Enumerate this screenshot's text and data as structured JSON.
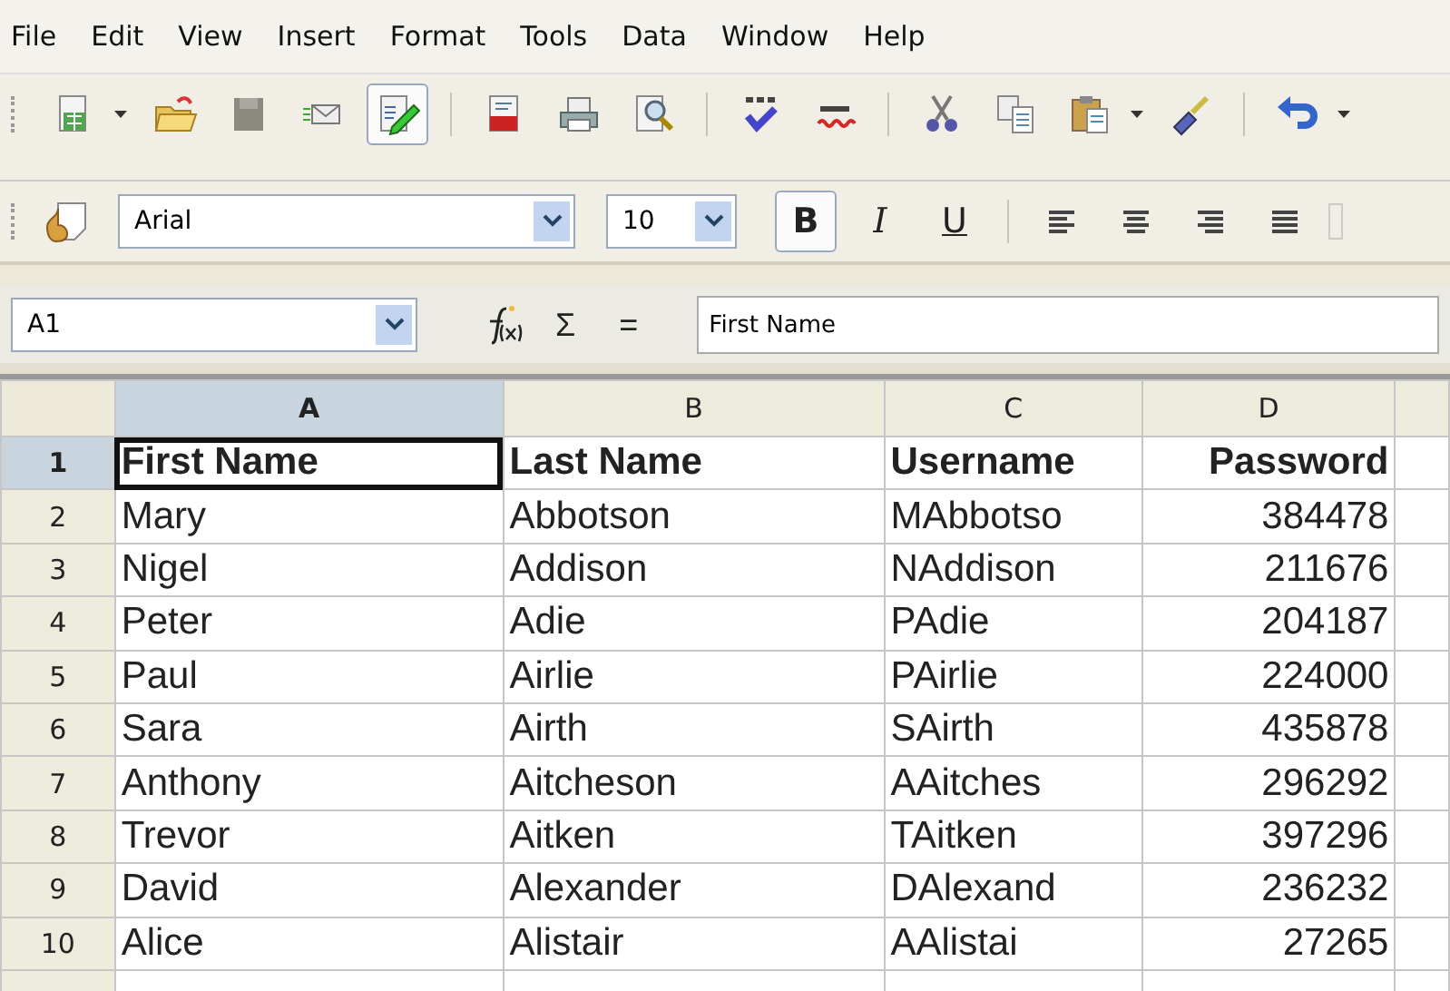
{
  "menu": [
    "File",
    "Edit",
    "View",
    "Insert",
    "Format",
    "Tools",
    "Data",
    "Window",
    "Help"
  ],
  "standard_toolbar": [
    {
      "kind": "new",
      "pressed": false,
      "dropdown": true
    },
    {
      "kind": "open",
      "pressed": false,
      "dropdown": false
    },
    {
      "kind": "save",
      "pressed": false,
      "dropdown": false
    },
    {
      "kind": "mail",
      "pressed": false,
      "dropdown": false
    },
    {
      "kind": "edit",
      "pressed": true,
      "dropdown": false
    },
    {
      "kind": "sep"
    },
    {
      "kind": "pdf",
      "pressed": false,
      "dropdown": false
    },
    {
      "kind": "print",
      "pressed": false,
      "dropdown": false
    },
    {
      "kind": "preview",
      "pressed": false,
      "dropdown": false
    },
    {
      "kind": "sep"
    },
    {
      "kind": "spell",
      "pressed": false,
      "dropdown": false
    },
    {
      "kind": "autospell",
      "pressed": false,
      "dropdown": false
    },
    {
      "kind": "sep"
    },
    {
      "kind": "cut",
      "pressed": false,
      "dropdown": false
    },
    {
      "kind": "copy",
      "pressed": false,
      "dropdown": false
    },
    {
      "kind": "paste",
      "pressed": false,
      "dropdown": true
    },
    {
      "kind": "brush",
      "pressed": false,
      "dropdown": false
    },
    {
      "kind": "sep"
    },
    {
      "kind": "undo",
      "pressed": false,
      "dropdown": true
    }
  ],
  "font_name": "Arial",
  "font_size": "10",
  "format_toolbar": [
    {
      "kind": "bold",
      "label": "B",
      "pressed": true
    },
    {
      "kind": "italic",
      "label": "I",
      "pressed": false
    },
    {
      "kind": "underline",
      "label": "U",
      "pressed": false
    },
    {
      "kind": "sep"
    },
    {
      "kind": "align-left",
      "pressed": false
    },
    {
      "kind": "align-center",
      "pressed": false
    },
    {
      "kind": "align-right",
      "pressed": false
    },
    {
      "kind": "justify",
      "pressed": false
    }
  ],
  "name_box": "A1",
  "formula_symbols": [
    "Σ",
    "="
  ],
  "formula": "First Name",
  "columns": [
    {
      "label": "A",
      "selected": true
    },
    {
      "label": "B",
      "selected": false
    },
    {
      "label": "C",
      "selected": false
    },
    {
      "label": "D",
      "selected": false
    }
  ],
  "rows": [
    {
      "number": "1",
      "selected": true,
      "bold": true,
      "cells": [
        "First Name",
        "Last Name",
        "Username",
        "Password"
      ]
    },
    {
      "number": "2",
      "selected": false,
      "bold": false,
      "cells": [
        "Mary",
        "Abbotson",
        "MAbbotso",
        "384478"
      ]
    },
    {
      "number": "3",
      "selected": false,
      "bold": false,
      "cells": [
        "Nigel",
        "Addison",
        "NAddison",
        "211676"
      ]
    },
    {
      "number": "4",
      "selected": false,
      "bold": false,
      "cells": [
        "Peter",
        "Adie",
        "PAdie",
        "204187"
      ]
    },
    {
      "number": "5",
      "selected": false,
      "bold": false,
      "cells": [
        "Paul",
        "Airlie",
        "PAirlie",
        "224000"
      ]
    },
    {
      "number": "6",
      "selected": false,
      "bold": false,
      "cells": [
        "Sara",
        "Airth",
        "SAirth",
        "435878"
      ]
    },
    {
      "number": "7",
      "selected": false,
      "bold": false,
      "cells": [
        "Anthony",
        "Aitcheson",
        "AAitches",
        "296292"
      ]
    },
    {
      "number": "8",
      "selected": false,
      "bold": false,
      "cells": [
        "Trevor",
        "Aitken",
        "TAitken",
        "397296"
      ]
    },
    {
      "number": "9",
      "selected": false,
      "bold": false,
      "cells": [
        "David",
        "Alexander",
        "DAlexand",
        "236232"
      ]
    },
    {
      "number": "10",
      "selected": false,
      "bold": false,
      "cells": [
        "Alice",
        "Alistair",
        "AAlistai",
        "27265"
      ]
    }
  ]
}
